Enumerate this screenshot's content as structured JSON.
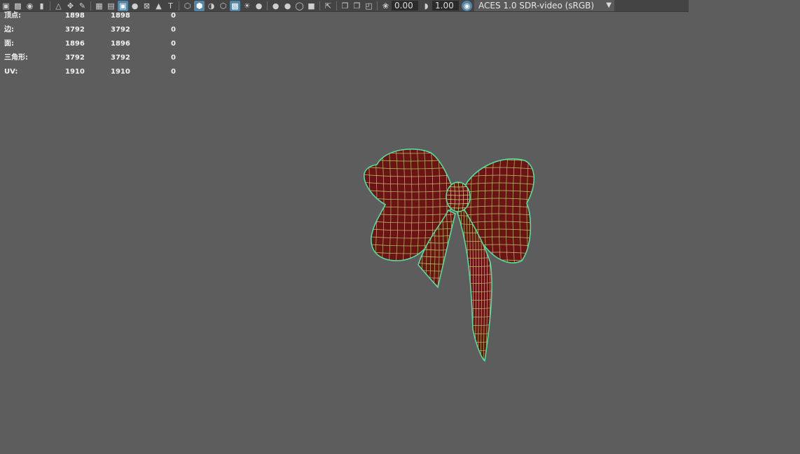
{
  "toolbar": {
    "exposure_value": "0.00",
    "gamma_value": "1.00",
    "color_management": "ACES 1.0 SDR-video (sRGB)",
    "icons": [
      "camera-icon",
      "camera-attributes-icon",
      "bookmark-icon",
      "image-plane-icon",
      "grease-pencil-icon",
      "2d-pan-zoom-icon",
      "grid-icon",
      "film-gate-icon",
      "resolution-gate-icon",
      "gate-mask-icon",
      "field-chart-icon",
      "safe-action-icon",
      "safe-title-icon",
      "wireframe-icon",
      "smooth-shade-icon",
      "default-material-icon",
      "textured-icon",
      "use-all-lights-icon",
      "shadows-icon",
      "screen-space-ao-icon",
      "motion-blur-icon",
      "multisample-aa-icon",
      "depth-of-field-icon",
      "isolate-select-icon",
      "xray-icon",
      "xray-joints-icon",
      "xray-components-icon",
      "exposure-icon",
      "gamma-icon",
      "color-management-icon"
    ]
  },
  "hud": {
    "rows": [
      {
        "label": "顶点:",
        "c1": "1898",
        "c2": "1898",
        "c3": "0"
      },
      {
        "label": "边:",
        "c1": "3792",
        "c2": "3792",
        "c3": "0"
      },
      {
        "label": "面:",
        "c1": "1896",
        "c2": "1896",
        "c3": "0"
      },
      {
        "label": "三角形:",
        "c1": "3792",
        "c2": "3792",
        "c3": "0"
      },
      {
        "label": "UV:",
        "c1": "1910",
        "c2": "1910",
        "c3": "0"
      }
    ]
  },
  "colors": {
    "viewport_bg": "#5d5d5d",
    "mesh_fill": "#6b1414",
    "wireframe": "#c7e07a",
    "selection_outline": "#4fe0a0",
    "active_icon_bg": "#5285a6"
  }
}
